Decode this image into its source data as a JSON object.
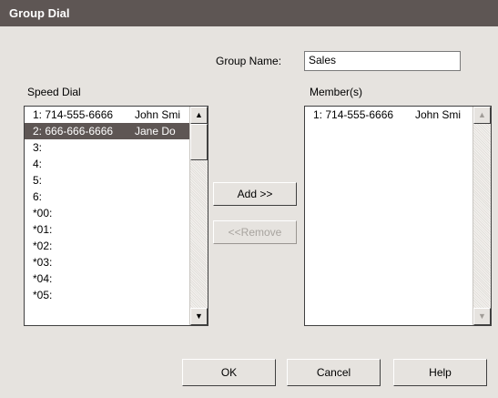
{
  "window": {
    "title": "Group Dial"
  },
  "group": {
    "label": "Group Name:",
    "value": "Sales"
  },
  "speed_dial": {
    "label": "Speed Dial",
    "items": [
      {
        "number": "1:  714-555-6666",
        "name": "John Smi"
      },
      {
        "number": "2:  666-666-6666",
        "name": "Jane Do",
        "selected": true
      },
      {
        "number": "3:",
        "name": ""
      },
      {
        "number": "4:",
        "name": ""
      },
      {
        "number": "5:",
        "name": ""
      },
      {
        "number": "6:",
        "name": ""
      },
      {
        "number": "*00:",
        "name": ""
      },
      {
        "number": "*01:",
        "name": ""
      },
      {
        "number": "*02:",
        "name": ""
      },
      {
        "number": "*03:",
        "name": ""
      },
      {
        "number": "*04:",
        "name": ""
      },
      {
        "number": "*05:",
        "name": ""
      }
    ]
  },
  "members": {
    "label": "Member(s)",
    "items": [
      {
        "number": "1:  714-555-6666",
        "name": "John Smi"
      }
    ]
  },
  "buttons": {
    "add": "Add >>",
    "remove": "<<Remove",
    "ok": "OK",
    "cancel": "Cancel",
    "help": "Help"
  },
  "icons": {
    "scroll_up": "up-arrow-icon",
    "scroll_down": "down-arrow-icon"
  },
  "colors": {
    "titlebar": "#5e5654",
    "selection": "#5e5654",
    "dialog_bg": "#e6e3df"
  }
}
